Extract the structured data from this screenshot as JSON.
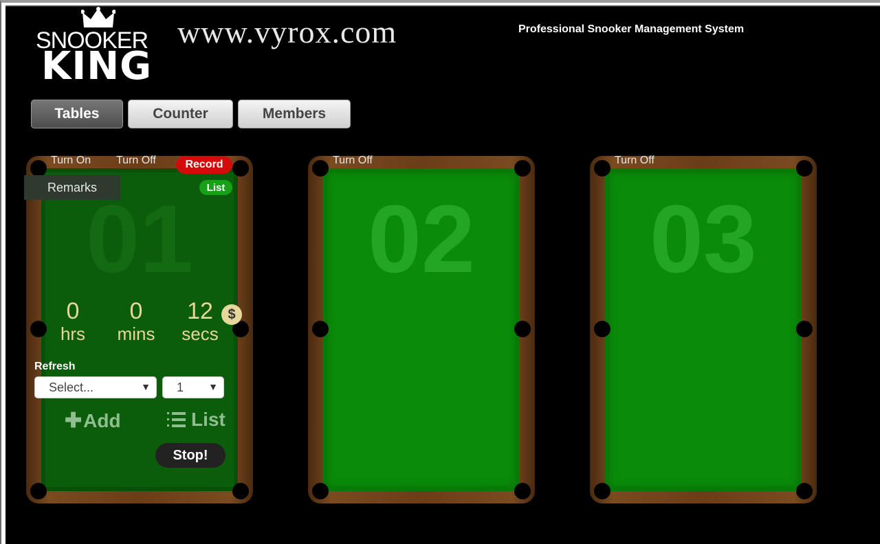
{
  "branding": {
    "logo_top": "SNOOKER",
    "logo_bottom": "KING",
    "site": "www.vyrox.com",
    "tagline": "Professional Snooker Management System"
  },
  "tabs": [
    {
      "label": "Tables",
      "active": true
    },
    {
      "label": "Counter",
      "active": false
    },
    {
      "label": "Members",
      "active": false
    }
  ],
  "tables": [
    {
      "number": "01",
      "active": true,
      "turn_on_label": "Turn On",
      "turn_off_label": "Turn Off",
      "record_label": "Record",
      "remarks_label": "Remarks",
      "list_badge_label": "List",
      "time": {
        "hrs": "0",
        "hrs_label": "hrs",
        "mins": "0",
        "mins_label": "mins",
        "secs": "12",
        "secs_label": "secs"
      },
      "currency_symbol": "$",
      "refresh_label": "Refresh",
      "select_value": "Select...",
      "qty_value": "1",
      "add_label": "Add",
      "list_label": "List",
      "stop_label": "Stop!"
    },
    {
      "number": "02",
      "active": false,
      "turn_off_label": "Turn Off"
    },
    {
      "number": "03",
      "active": false,
      "turn_off_label": "Turn Off"
    }
  ],
  "colors": {
    "background": "#000000",
    "felt": "#0a8c0a",
    "felt_dim": "#0b5c0b",
    "rail": "#6b3d18",
    "record_badge": "#d40b0b",
    "list_badge": "#17a117",
    "timer_text": "#e6d79a"
  }
}
